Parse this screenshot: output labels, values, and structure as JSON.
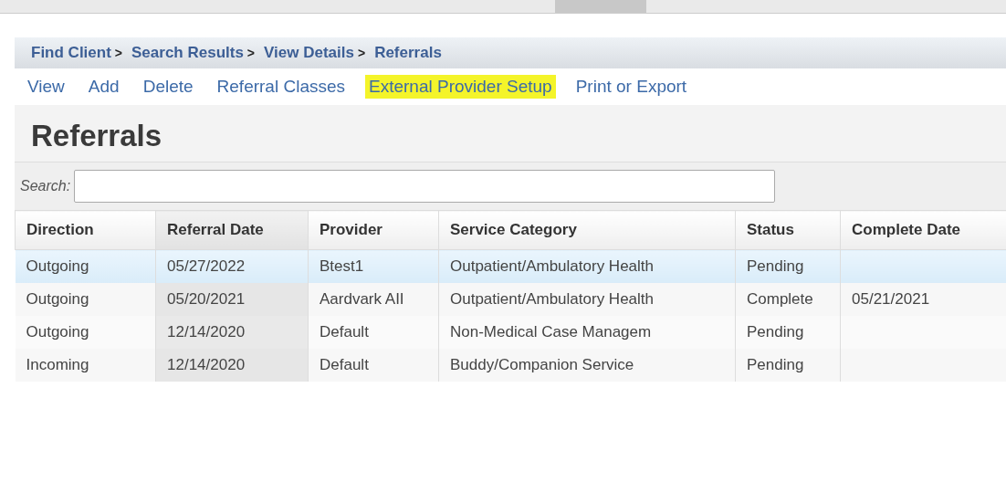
{
  "breadcrumb": [
    {
      "label": "Find Client",
      "separator": ">"
    },
    {
      "label": "Search Results",
      "separator": ">"
    },
    {
      "label": "View Details",
      "separator": ">"
    },
    {
      "label": "Referrals"
    }
  ],
  "actions": [
    {
      "label": "View",
      "highlighted": false
    },
    {
      "label": "Add",
      "highlighted": false
    },
    {
      "label": "Delete",
      "highlighted": false
    },
    {
      "label": "Referral Classes",
      "highlighted": false
    },
    {
      "label": "External Provider Setup",
      "highlighted": true
    },
    {
      "label": "Print or Export",
      "highlighted": false
    }
  ],
  "heading": "Referrals",
  "search": {
    "label": "Search:"
  },
  "table": {
    "columns": [
      {
        "label": "Direction",
        "sorted": false
      },
      {
        "label": "Referral Date",
        "sorted": true
      },
      {
        "label": "Provider",
        "sorted": false
      },
      {
        "label": "Service Category",
        "sorted": false
      },
      {
        "label": "Status",
        "sorted": false
      },
      {
        "label": "Complete Date",
        "sorted": false
      }
    ],
    "rows": [
      {
        "selected": true,
        "cells": [
          "Outgoing",
          "05/27/2022",
          "Btest1",
          "Outpatient/Ambulatory Health",
          "Pending",
          ""
        ]
      },
      {
        "selected": false,
        "cells": [
          "Outgoing",
          "05/20/2021",
          "Aardvark AII",
          "Outpatient/Ambulatory Health",
          "Complete",
          "05/21/2021"
        ]
      },
      {
        "selected": false,
        "cells": [
          "Outgoing",
          "12/14/2020",
          "Default",
          "Non-Medical Case Managem",
          "Pending",
          ""
        ]
      },
      {
        "selected": false,
        "cells": [
          "Incoming",
          "12/14/2020",
          "Default",
          "Buddy/Companion Service",
          "Pending",
          ""
        ]
      }
    ]
  }
}
